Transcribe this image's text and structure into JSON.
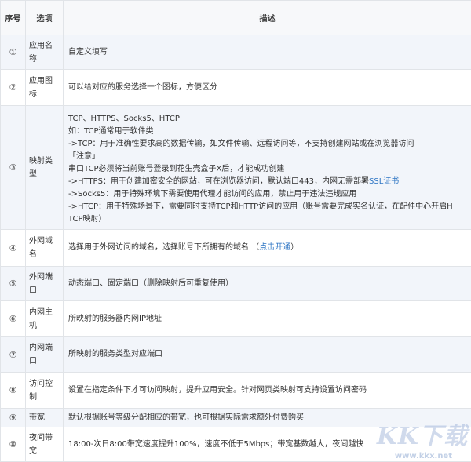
{
  "headers": {
    "no": "序号",
    "option": "选项",
    "desc": "描述"
  },
  "rows": [
    {
      "no": "①",
      "option": "应用名称",
      "desc": "自定义填写"
    },
    {
      "no": "②",
      "option": "应用图标",
      "desc": "可以给对应的服务选择一个图标，方便区分"
    },
    {
      "no": "③",
      "option": "映射类型",
      "lines": [
        "TCP、HTTPS、Socks5、HTCP",
        "如：TCP通常用于软件类",
        "->TCP：用于准确性要求高的数据传输，如文件传输、远程访问等，不支持创建网站或在浏览器访问",
        "「注意」",
        "串口TCP必须将当前账号登录到花生壳盒子X后，才能成功创建",
        "->HTTPS：用于创建加密安全的网站，可在浏览器访问，默认端口443，内网无需部署",
        "->Socks5：用于特殊环境下需要使用代理才能访问的应用，禁止用于违法违规应用",
        "->HTCP：用于特殊场景下，需要同时支持TCP和HTTP访问的应用（账号需要完成实名认证，在配件中心开启H",
        "TCP映射）"
      ],
      "ssl_link": "SSL证书"
    },
    {
      "no": "④",
      "option": "外网域名",
      "desc": "选择用于外网访问的域名，选择账号下所拥有的域名 （",
      "link": "点击开通",
      "desc_end": "）"
    },
    {
      "no": "⑤",
      "option": "外网端口",
      "desc": "动态端口、固定端口（删除映射后可重复使用）"
    },
    {
      "no": "⑥",
      "option": "内网主机",
      "desc": "所映射的服务器内网IP地址"
    },
    {
      "no": "⑦",
      "option": "内网端口",
      "desc": "所映射的服务类型对应端口"
    },
    {
      "no": "⑧",
      "option": "访问控制",
      "desc": "设置在指定条件下才可访问映射，提升应用安全。针对网页类映射可支持设置访问密码"
    },
    {
      "no": "⑨",
      "option": "带宽",
      "desc": "默认根据账号等级分配相应的带宽，也可根据实际需求额外付费购买"
    },
    {
      "no": "⑩",
      "option": "夜间带宽",
      "desc": "18:00-次日8:00带宽速度提升100%，速度不低于5Mbps；带宽基数越大，夜间越快"
    }
  ],
  "watermark": {
    "logo": "KK下载",
    "url": "www.kkx.net"
  }
}
